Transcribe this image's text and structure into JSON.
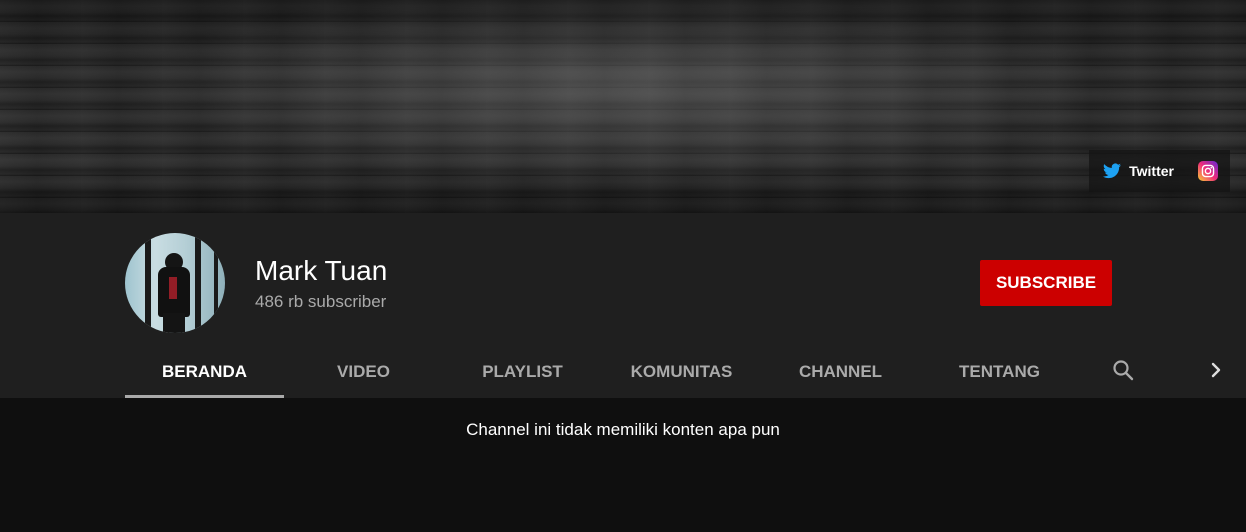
{
  "banner": {
    "links": [
      {
        "label": "Twitter",
        "icon": "twitter-icon"
      },
      {
        "label": "",
        "icon": "instagram-icon"
      }
    ]
  },
  "channel": {
    "name": "Mark Tuan",
    "subscribers": "486 rb subscriber",
    "subscribe_label": "SUBSCRIBE"
  },
  "tabs": [
    {
      "label": "BERANDA",
      "active": true
    },
    {
      "label": "VIDEO",
      "active": false
    },
    {
      "label": "PLAYLIST",
      "active": false
    },
    {
      "label": "KOMUNITAS",
      "active": false
    },
    {
      "label": "CHANNEL",
      "active": false
    },
    {
      "label": "TENTANG",
      "active": false
    }
  ],
  "tab_icons": {
    "search": "search-icon",
    "next": "chevron-right-icon"
  },
  "content": {
    "empty_message": "Channel ini tidak memiliki konten apa pun"
  },
  "colors": {
    "subscribe_bg": "#cc0000",
    "header_bg": "#1f1f1f",
    "page_bg": "#0f0f0f",
    "twitter_blue": "#1da1f2"
  }
}
